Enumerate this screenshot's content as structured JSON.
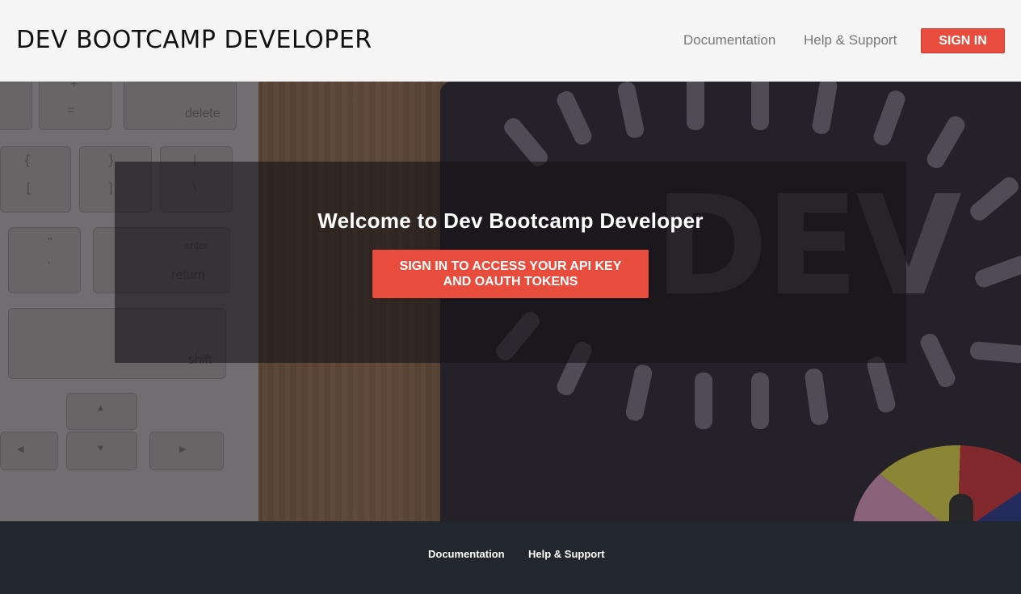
{
  "header": {
    "brand": "DEV BOOTCAMP DEVELOPER",
    "nav": {
      "documentation": "Documentation",
      "help": "Help & Support",
      "sign_in": "SIGN IN"
    }
  },
  "hero": {
    "title": "Welcome to Dev Bootcamp Developer",
    "cta_line1": "SIGN IN TO ACCESS YOUR API KEY",
    "cta_line2": "AND OAUTH TOKENS",
    "background": {
      "keyboard_keys": [
        "delete",
        "+",
        "=",
        "{",
        "[",
        "}",
        "]",
        "|",
        "\\",
        "\"",
        "'",
        "enter",
        "return",
        "shift",
        "▲",
        "▼",
        "◀",
        "▶"
      ],
      "mat_text": "DEV"
    }
  },
  "footer": {
    "documentation": "Documentation",
    "help": "Help & Support"
  },
  "colors": {
    "accent": "#e84c3d",
    "header_bg": "#f5f5f5",
    "footer_bg": "#22272d"
  }
}
